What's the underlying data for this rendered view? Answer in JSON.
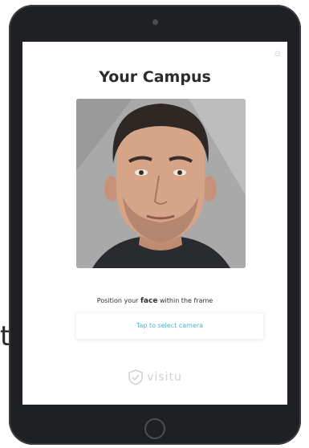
{
  "stray_text": "t",
  "app": {
    "title": "Your Campus",
    "corner_mark": "⊙"
  },
  "face_prompt": {
    "before": "Position your ",
    "emphasis": "face",
    "after": " within the frame"
  },
  "camera_select": {
    "label": "Tap to select camera"
  },
  "brand": {
    "name": "visitu"
  },
  "colors": {
    "accent": "#4bb4ca",
    "device_frame": "#1f2023"
  }
}
